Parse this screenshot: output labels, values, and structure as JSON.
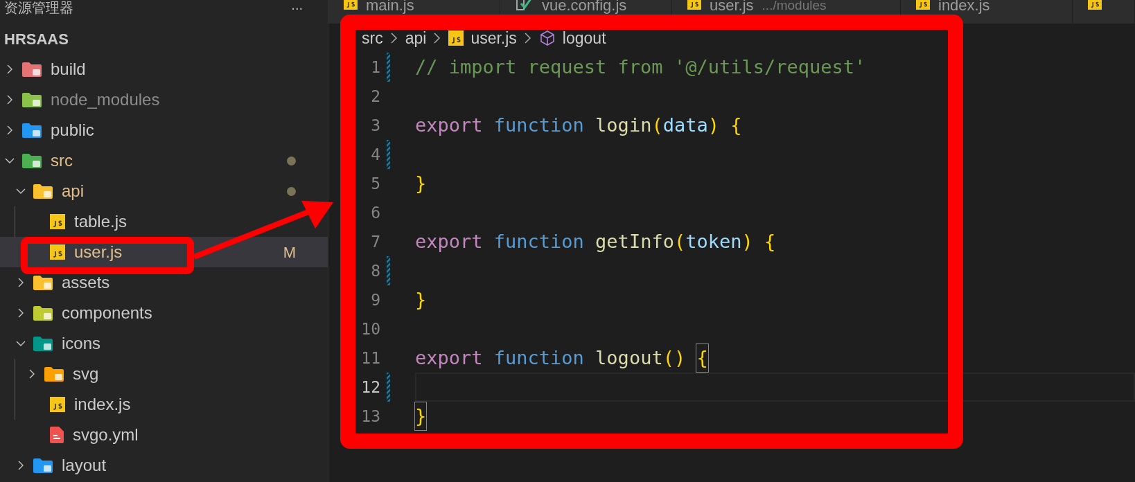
{
  "sidebar": {
    "title": "资源管理器",
    "more": "...",
    "section": "HRSAAS",
    "tree": [
      {
        "name": "build",
        "kind": "folder-build",
        "expanded": false,
        "modified": false,
        "ignored": false
      },
      {
        "name": "node_modules",
        "kind": "folder-node",
        "expanded": false,
        "modified": false,
        "ignored": true
      },
      {
        "name": "public",
        "kind": "folder-public",
        "expanded": false,
        "modified": false,
        "ignored": false
      },
      {
        "name": "src",
        "kind": "folder-src",
        "expanded": true,
        "modified": true,
        "dot": true,
        "children": [
          {
            "name": "api",
            "kind": "folder-api",
            "expanded": true,
            "modified": true,
            "dot": true,
            "children": [
              {
                "name": "table.js",
                "kind": "js",
                "modified": false,
                "ignored": false,
                "selected": false
              },
              {
                "name": "user.js",
                "kind": "js",
                "modified": true,
                "badge": "M",
                "selected": true
              }
            ]
          },
          {
            "name": "assets",
            "kind": "folder-assets",
            "expanded": false,
            "modified": false,
            "ignored": false
          },
          {
            "name": "components",
            "kind": "folder-components",
            "expanded": false,
            "modified": false,
            "ignored": false
          },
          {
            "name": "icons",
            "kind": "folder-icons",
            "expanded": true,
            "modified": false,
            "ignored": false,
            "children": [
              {
                "name": "svg",
                "kind": "folder-svg",
                "expanded": false,
                "modified": false,
                "ignored": false
              },
              {
                "name": "index.js",
                "kind": "js",
                "modified": false,
                "ignored": false,
                "selected": false
              },
              {
                "name": "svgo.yml",
                "kind": "yml",
                "modified": false,
                "ignored": false,
                "selected": false
              }
            ]
          },
          {
            "name": "layout",
            "kind": "folder-layout",
            "expanded": false,
            "modified": false,
            "ignored": false
          }
        ]
      }
    ]
  },
  "tabs": [
    {
      "label": "main.js",
      "kind": "js",
      "selected": false
    },
    {
      "label": "vue.config.js",
      "kind": "vue",
      "selected": false
    },
    {
      "label": "user.js",
      "detail": ".../modules",
      "kind": "js",
      "selected": false
    },
    {
      "label": "index.js",
      "kind": "js",
      "selected": false
    },
    {
      "kind": "js",
      "selected": false
    }
  ],
  "breadcrumb": [
    {
      "label": "src",
      "kind": "folder"
    },
    {
      "label": "api",
      "kind": "folder"
    },
    {
      "label": "user.js",
      "kind": "js"
    },
    {
      "label": "logout",
      "kind": "symbol"
    }
  ],
  "editor": {
    "lines": [
      {
        "number": "1",
        "modified": true,
        "current": false,
        "tokens": [
          {
            "kind": "comment",
            "text": "// import request from '@/utils/request'"
          }
        ]
      },
      {
        "number": "2",
        "modified": false,
        "current": false
      },
      {
        "number": "3",
        "modified": false,
        "current": false,
        "tokens": [
          {
            "kind": "keyword",
            "text": "export "
          },
          {
            "kind": "storage",
            "text": "function "
          },
          {
            "kind": "function",
            "text": "login"
          },
          {
            "kind": "paren",
            "text": "("
          },
          {
            "kind": "param",
            "text": "data"
          },
          {
            "kind": "paren",
            "text": ") "
          },
          {
            "kind": "brace",
            "text": "{",
            "matched": false
          }
        ]
      },
      {
        "number": "4",
        "modified": true,
        "current": false
      },
      {
        "number": "5",
        "modified": false,
        "current": false,
        "tokens": [
          {
            "kind": "brace",
            "text": "}",
            "matched": false
          }
        ]
      },
      {
        "number": "6",
        "modified": false,
        "current": false
      },
      {
        "number": "7",
        "modified": false,
        "current": false,
        "tokens": [
          {
            "kind": "keyword",
            "text": "export "
          },
          {
            "kind": "storage",
            "text": "function "
          },
          {
            "kind": "function",
            "text": "getInfo"
          },
          {
            "kind": "paren",
            "text": "("
          },
          {
            "kind": "param",
            "text": "token"
          },
          {
            "kind": "paren",
            "text": ") "
          },
          {
            "kind": "brace",
            "text": "{",
            "matched": false
          }
        ]
      },
      {
        "number": "8",
        "modified": true,
        "current": false
      },
      {
        "number": "9",
        "modified": false,
        "current": false,
        "tokens": [
          {
            "kind": "brace",
            "text": "}",
            "matched": false
          }
        ]
      },
      {
        "number": "10",
        "modified": false,
        "current": false
      },
      {
        "number": "11",
        "modified": false,
        "current": false,
        "tokens": [
          {
            "kind": "keyword",
            "text": "export "
          },
          {
            "kind": "storage",
            "text": "function "
          },
          {
            "kind": "function",
            "text": "logout"
          },
          {
            "kind": "paren",
            "text": "() "
          },
          {
            "kind": "brace",
            "text": "{",
            "matched": true
          }
        ]
      },
      {
        "number": "12",
        "modified": true,
        "current": true
      },
      {
        "number": "13",
        "modified": false,
        "current": false,
        "tokens": [
          {
            "kind": "brace",
            "text": "}",
            "matched": true
          }
        ]
      }
    ]
  }
}
